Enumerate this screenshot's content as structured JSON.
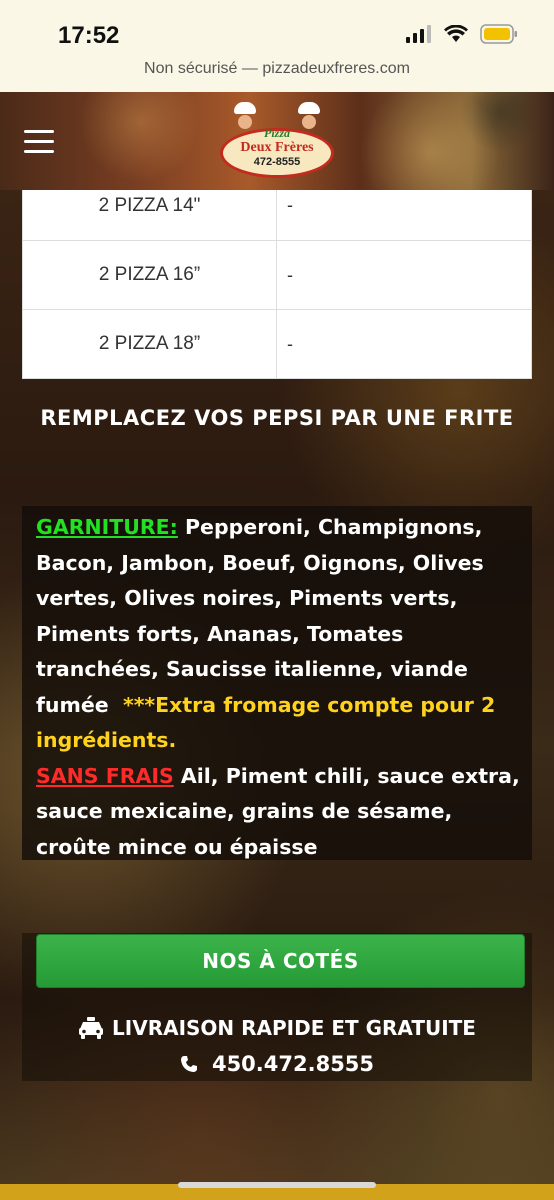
{
  "status_bar": {
    "time": "17:52",
    "url_text": "Non sécurisé — pizzadeuxfreres.com"
  },
  "header": {
    "logo_top": "Pizza",
    "logo_name": "Deux Frères",
    "logo_phone": "472-8555"
  },
  "table": {
    "rows": [
      {
        "size": "2 PIZZA 14\"",
        "price": "-"
      },
      {
        "size": "2 PIZZA 16”",
        "price": "-"
      },
      {
        "size": "2 PIZZA 18”",
        "price": "-"
      }
    ]
  },
  "section_title": "REMPLACEZ VOS PEPSI PAR UNE FRITE",
  "garniture": {
    "label": "GARNITURE:",
    "items": " Pepperoni, Champignons, Bacon, Jambon, Boeuf, Oignons, Olives vertes, Olives noires, Piments verts, Piments forts, Ananas, Tomates tranchées, Saucisse italienne, viande fumée",
    "extra_note": "***Extra fromage compte pour 2 ingrédients.",
    "sans_frais_label": "SANS FRAIS",
    "sans_frais_items": " Ail, Piment chili, sauce extra, sauce mexicaine, grains de sésame, croûte mince ou épaisse"
  },
  "cta": {
    "label": "NOS À COTÉS"
  },
  "delivery": {
    "label": "LIVRAISON RAPIDE ET GRATUITE",
    "phone": "450.472.8555"
  },
  "colors": {
    "garniture_label": "#22e022",
    "extra_note": "#ffd21e",
    "sans_frais_label": "#ff2a2a",
    "cta_green": "#2ea23e"
  },
  "icons": {
    "taxi": "taxi-icon",
    "phone": "phone-icon",
    "menu": "hamburger-icon"
  }
}
